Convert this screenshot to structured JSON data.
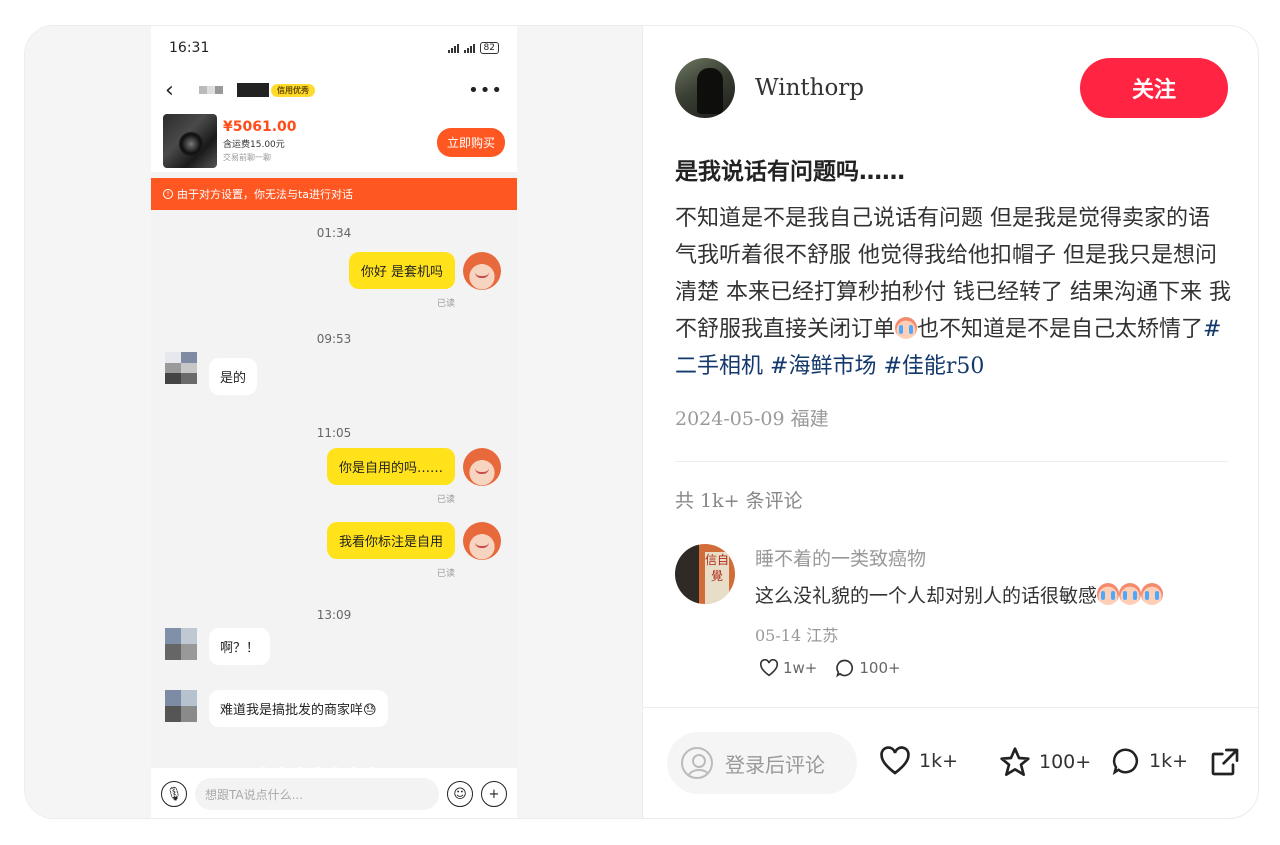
{
  "phone": {
    "time": "16:31",
    "battery": "82",
    "header": {
      "back_icon": "chevron-left-icon",
      "credit_badge": "信用优秀",
      "more_icon": "more-dots-icon"
    },
    "product": {
      "price": "¥5061.00",
      "shipping": "含运费15.00元",
      "chat_hint": "交易前聊一聊",
      "buy_label": "立即购买"
    },
    "notice": "由于对方设置，你无法与ta进行对话",
    "messages": [
      {
        "type": "time",
        "text": "01:34"
      },
      {
        "type": "out",
        "text": "你好 是套机吗",
        "read": "已读"
      },
      {
        "type": "time",
        "text": "09:53"
      },
      {
        "type": "in",
        "text": "是的"
      },
      {
        "type": "time",
        "text": "11:05"
      },
      {
        "type": "out",
        "text": "你是自用的吗……",
        "read": "已读"
      },
      {
        "type": "out",
        "text": "我看你标注是自用",
        "read": "已读"
      },
      {
        "type": "time",
        "text": "13:09"
      },
      {
        "type": "in",
        "text": "啊？！"
      },
      {
        "type": "in",
        "text": "难道我是搞批发的商家咩😓"
      }
    ],
    "input_placeholder": "想跟TA说点什么...",
    "icons": {
      "mic": "microphone-icon",
      "emoji": "smiley-icon",
      "plus": "plus-icon"
    }
  },
  "post": {
    "author": "Winthorp",
    "follow_label": "关注",
    "title": "是我说话有问题吗……",
    "body": "不知道是不是我自己说话有问题 但是我是觉得卖家的语气我听着很不舒服 他觉得我给他扣帽子 但是我只是想问清楚 本来已经打算秒拍秒付 钱已经转了 结果沟通下来 我不舒服我直接关闭订单",
    "body_tail": "也不知道是不是自己太矫情了",
    "tags": [
      "#二手相机",
      "#海鲜市场",
      "#佳能r50"
    ],
    "date_location": "2024-05-09 福建",
    "comment_count": "共 1k+ 条评论"
  },
  "comment": {
    "user": "睡不着的一类致癌物",
    "text": "这么没礼貌的一个人却对别人的话很敏感",
    "meta": "05-14 江苏",
    "likes": "1w+",
    "replies": "100+",
    "avatar_sign": "信自覺"
  },
  "footer": {
    "login_placeholder": "登录后评论",
    "likes": "1k+",
    "favorites": "100+",
    "comments": "1k+"
  },
  "colors": {
    "accent_red": "#ff2442",
    "xianyu_yellow": "#ffe21a",
    "notice_orange": "#ff5722",
    "tag_blue": "#13386c"
  }
}
